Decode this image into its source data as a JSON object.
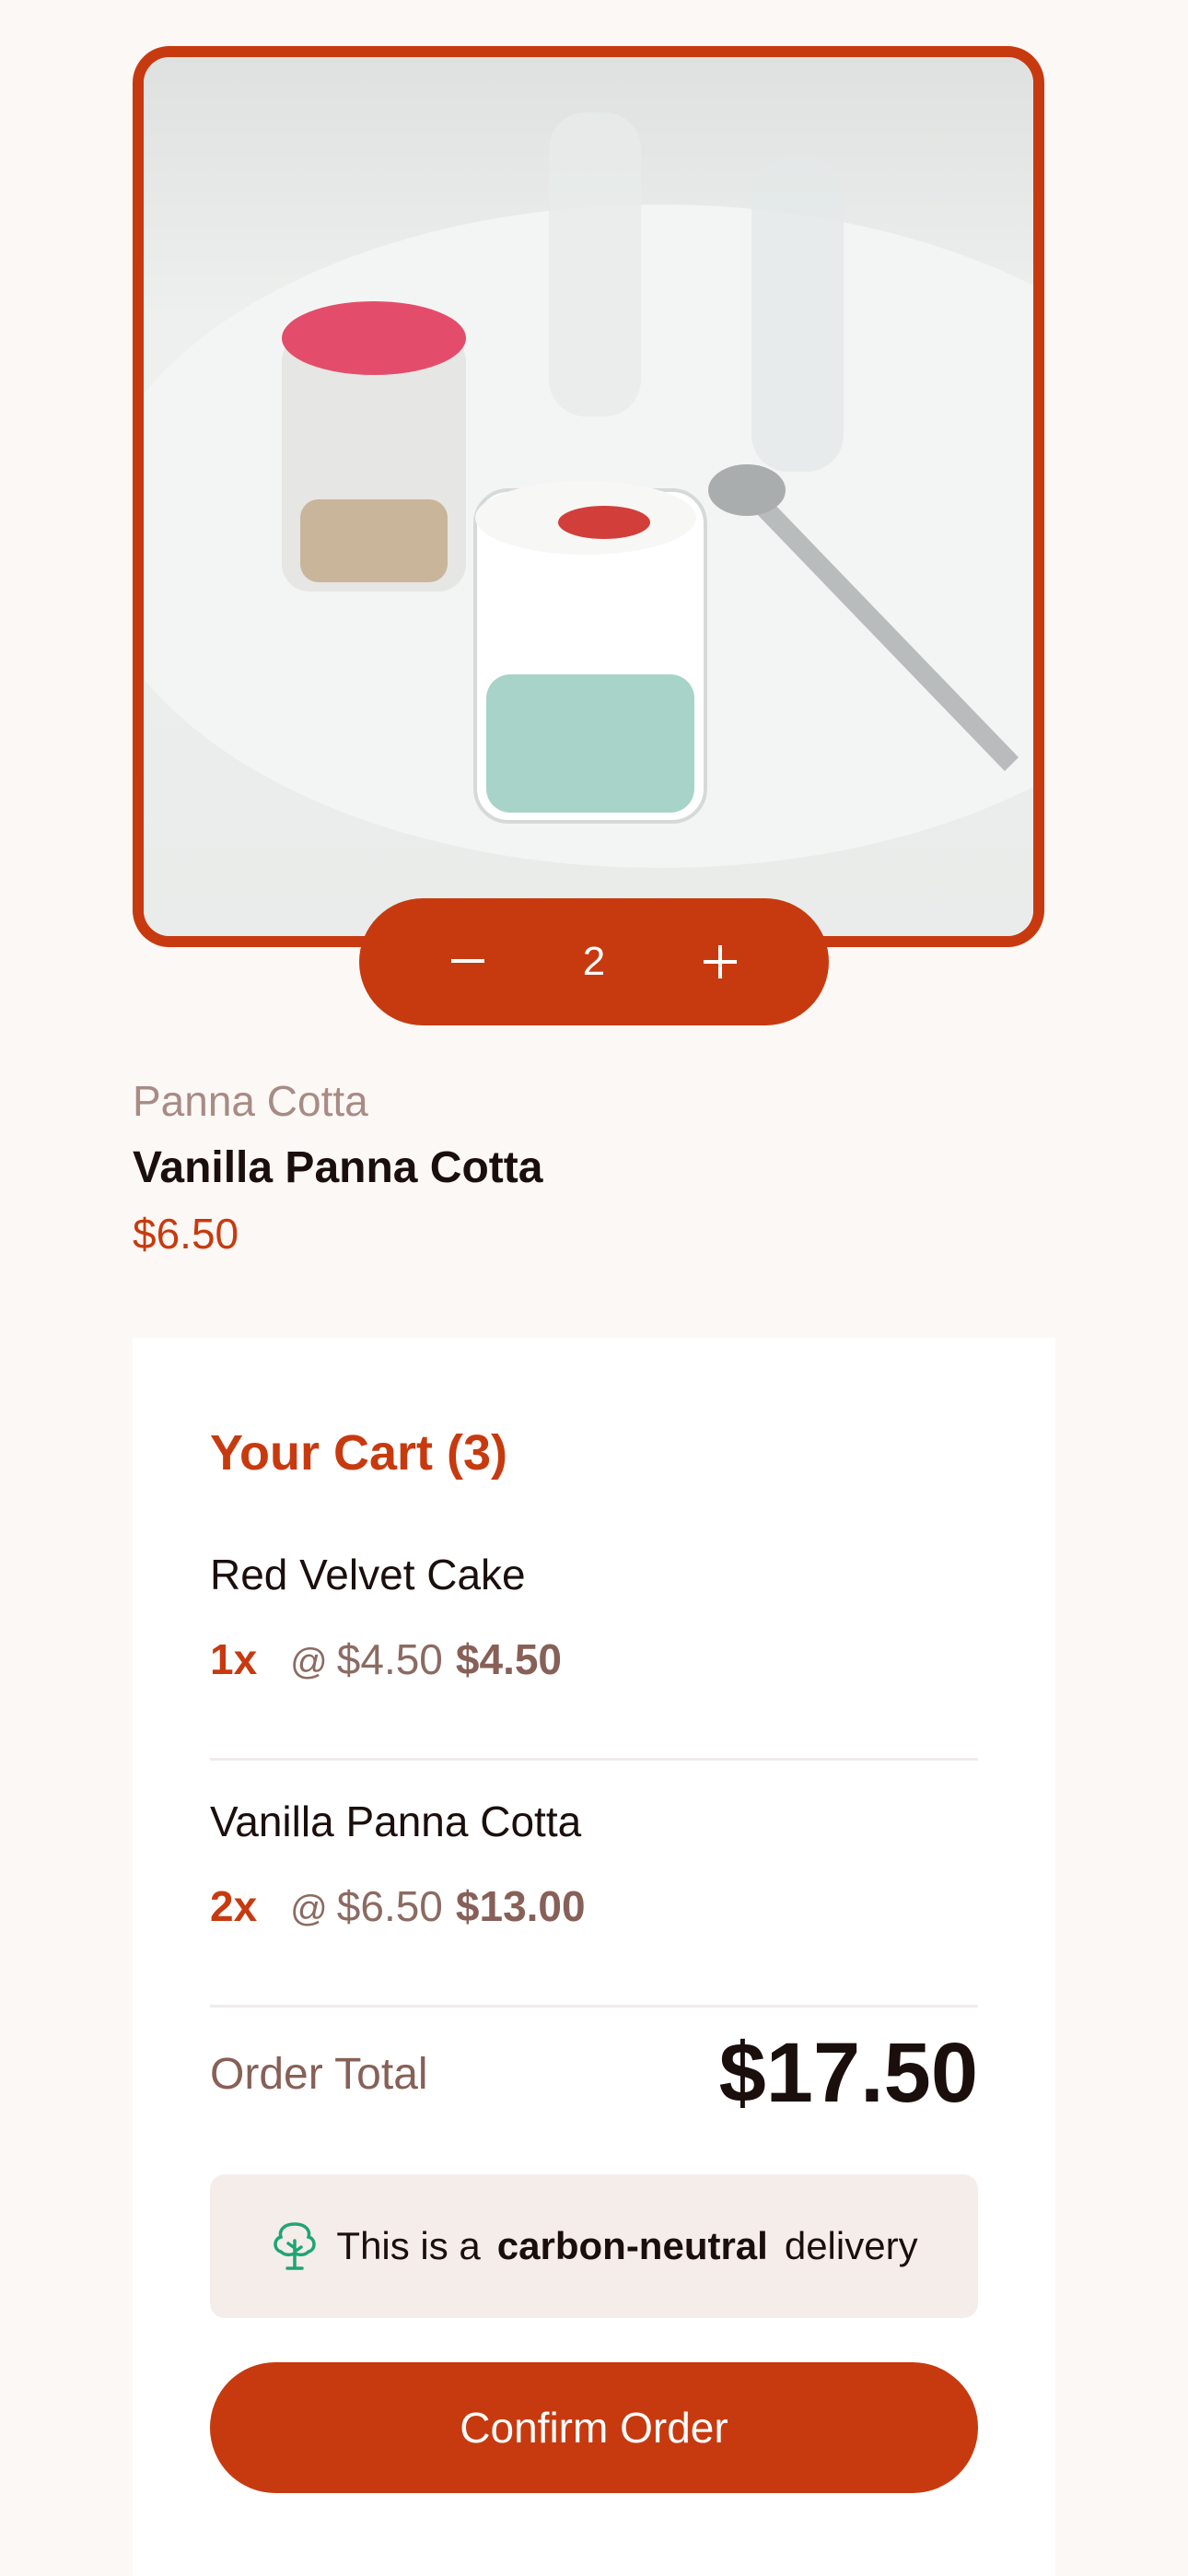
{
  "product": {
    "image_alt": "Vanilla Panna Cotta",
    "quantity": "2",
    "category": "Panna Cotta",
    "name": "Vanilla Panna Cotta",
    "price": "$6.50",
    "decrement_icon": "minus-icon",
    "increment_icon": "plus-icon"
  },
  "cart": {
    "title": "Your Cart (3)",
    "items": [
      {
        "name": "Red Velvet Cake",
        "count": "1x",
        "at": "@",
        "unit_price": "$4.50",
        "subtotal": "$4.50"
      },
      {
        "name": "Vanilla Panna Cotta",
        "count": "2x",
        "at": "@",
        "unit_price": "$6.50",
        "subtotal": "$13.00"
      }
    ],
    "order_total_label": "Order Total",
    "order_total": "$17.50",
    "note": {
      "icon": "carbon-neutral-tree-icon",
      "prefix": "This is a",
      "bold": "carbon-neutral",
      "suffix": "delivery"
    },
    "confirm_label": "Confirm Order"
  },
  "colors": {
    "accent": "#c73a0f",
    "background": "#fcf8f6",
    "muted": "#876058",
    "tree": "#1ea575"
  }
}
